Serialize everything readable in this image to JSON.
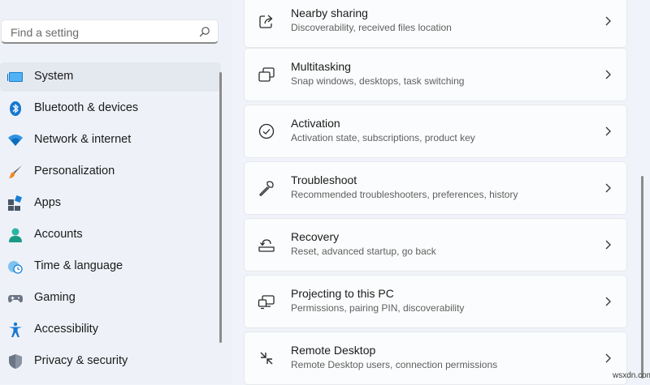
{
  "search": {
    "placeholder": "Find a setting"
  },
  "sidebar": {
    "items": [
      {
        "label": "System",
        "icon": "system-icon",
        "selected": true
      },
      {
        "label": "Bluetooth & devices",
        "icon": "bluetooth-icon"
      },
      {
        "label": "Network & internet",
        "icon": "wifi-icon"
      },
      {
        "label": "Personalization",
        "icon": "brush-icon"
      },
      {
        "label": "Apps",
        "icon": "apps-icon"
      },
      {
        "label": "Accounts",
        "icon": "account-icon"
      },
      {
        "label": "Time & language",
        "icon": "clock-globe-icon"
      },
      {
        "label": "Gaming",
        "icon": "gamepad-icon"
      },
      {
        "label": "Accessibility",
        "icon": "accessibility-icon"
      },
      {
        "label": "Privacy & security",
        "icon": "shield-icon"
      }
    ]
  },
  "main": {
    "cards": [
      {
        "title": "Nearby sharing",
        "subtitle": "Discoverability, received files location",
        "icon": "share-icon"
      },
      {
        "title": "Multitasking",
        "subtitle": "Snap windows, desktops, task switching",
        "icon": "multitasking-icon"
      },
      {
        "title": "Activation",
        "subtitle": "Activation state, subscriptions, product key",
        "icon": "check-circle-icon"
      },
      {
        "title": "Troubleshoot",
        "subtitle": "Recommended troubleshooters, preferences, history",
        "icon": "wrench-icon"
      },
      {
        "title": "Recovery",
        "subtitle": "Reset, advanced startup, go back",
        "icon": "recovery-icon"
      },
      {
        "title": "Projecting to this PC",
        "subtitle": "Permissions, pairing PIN, discoverability",
        "icon": "projecting-icon"
      },
      {
        "title": "Remote Desktop",
        "subtitle": "Remote Desktop users, connection permissions",
        "icon": "remote-desktop-icon"
      }
    ]
  },
  "watermark": "wsxdn.com",
  "colors": {
    "accent": "#0067c0",
    "card_bg": "#fbfcfd",
    "page_bg": "#f0f3f9"
  }
}
